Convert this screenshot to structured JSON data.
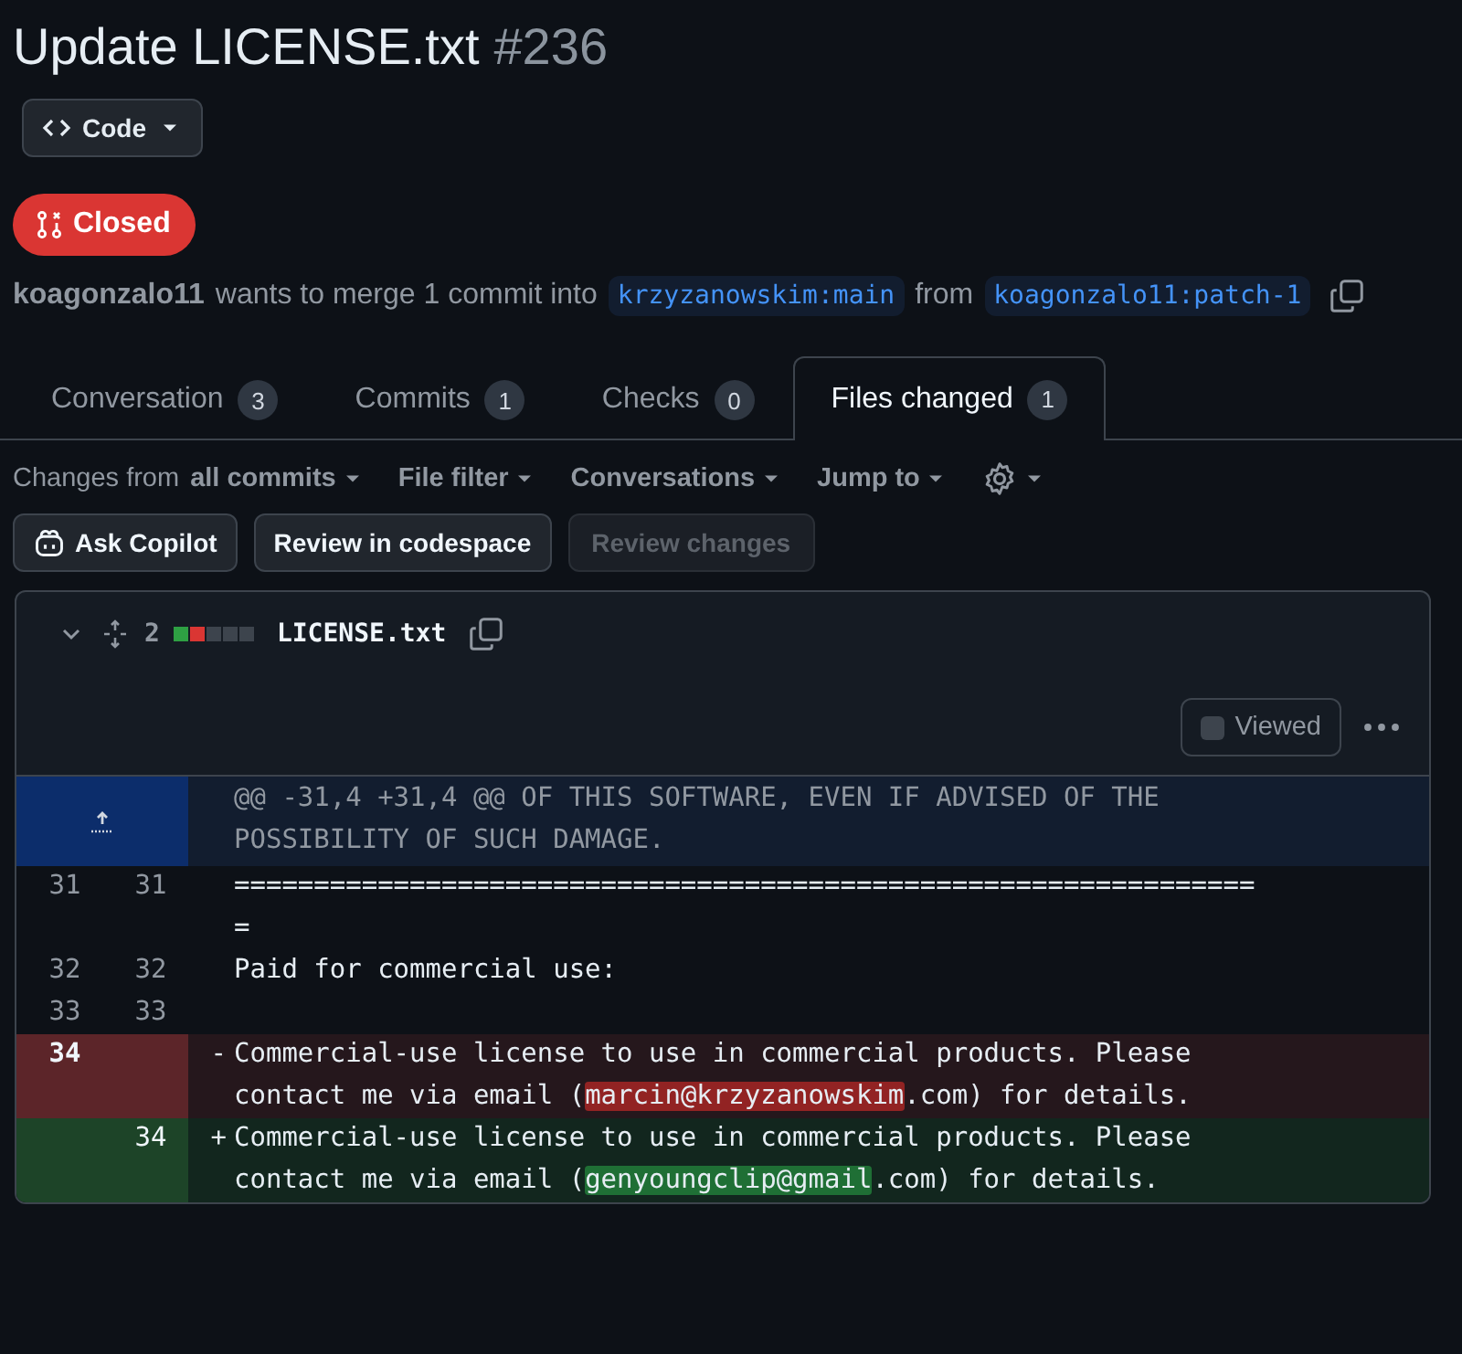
{
  "title": {
    "text": "Update LICENSE.txt",
    "number": "#236"
  },
  "code_button": {
    "label": "Code"
  },
  "state": {
    "label": "Closed",
    "kind": "closed"
  },
  "merge_info": {
    "author": "koagonzalo11",
    "text": "wants to merge 1 commit into",
    "base": "krzyzanowskim:main",
    "from": "from",
    "head": "koagonzalo11:patch-1"
  },
  "tabs": [
    {
      "label": "Conversation",
      "count": "3",
      "selected": false
    },
    {
      "label": "Commits",
      "count": "1",
      "selected": false
    },
    {
      "label": "Checks",
      "count": "0",
      "selected": false
    },
    {
      "label": "Files changed",
      "count": "1",
      "selected": true
    }
  ],
  "toolbar": [
    {
      "label": "Changes from",
      "value": "all commits",
      "kind": "text"
    },
    {
      "label": "File filter",
      "kind": "text"
    },
    {
      "label": "Conversations",
      "kind": "text"
    },
    {
      "label": "Jump to",
      "kind": "text"
    },
    {
      "kind": "settings"
    }
  ],
  "actions": [
    {
      "label": "Ask Copilot",
      "icon": true,
      "disabled": false
    },
    {
      "label": "Review in codespace",
      "icon": false,
      "disabled": false
    },
    {
      "label": "Review changes",
      "icon": false,
      "disabled": true
    }
  ],
  "file": {
    "expanded": true,
    "changes": "2",
    "diffstat": [
      {
        "kind": "add"
      },
      {
        "kind": "del"
      },
      {
        "kind": "neutral"
      },
      {
        "kind": "neutral"
      },
      {
        "kind": "neutral"
      }
    ],
    "name": "LICENSE.txt",
    "viewed": {
      "label": "Viewed",
      "checked": false
    },
    "hunk": "@@ -31,4 +31,4 @@ OF THIS SOFTWARE, EVEN IF ADVISED OF THE POSSIBILITY OF SUCH DAMAGE.",
    "lines": [
      {
        "kind": "context",
        "old": "31",
        "new": "31",
        "parts": [
          {
            "text": "=================================================================",
            "mark": false
          }
        ]
      },
      {
        "kind": "context",
        "old": "32",
        "new": "32",
        "parts": [
          {
            "text": "Paid for commercial use:",
            "mark": false
          }
        ]
      },
      {
        "kind": "context",
        "old": "33",
        "new": "33"
      },
      {
        "kind": "del",
        "old": "34",
        "sign": "-",
        "parts": [
          {
            "text": "Commercial-use license to use in commercial products. Please contact me via email (",
            "mark": false
          },
          {
            "text": "marcin@krzyzanowskim",
            "mark": true
          },
          {
            "text": ".com) for details.",
            "mark": false
          }
        ]
      },
      {
        "kind": "add",
        "new": "34",
        "sign": "+",
        "parts": [
          {
            "text": "Commercial-use license to use in commercial products. Please contact me via email (",
            "mark": false
          },
          {
            "text": "genyoungclip@gmail",
            "mark": true
          },
          {
            "text": ".com) for details.",
            "mark": false
          }
        ]
      }
    ]
  }
}
